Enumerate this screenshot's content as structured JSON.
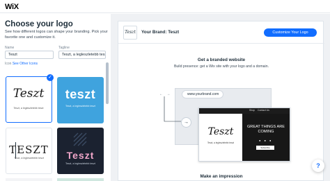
{
  "app": {
    "brand": "WiX"
  },
  "left": {
    "title": "Choose your logo",
    "subtitle": "See how different logos can shape your branding. Pick your favorite one and customize it.",
    "name_label": "Name",
    "name_value": "Teszt",
    "tagline_label": "Tagline",
    "tagline_value": "Teszt, a legleszletebb teszt",
    "icon_prefix": "Icon",
    "icon_link": "See Other Icons",
    "logos": [
      {
        "text": "Teszt",
        "tag": "Teszt, a legleszletebb teszt"
      },
      {
        "text": "teszt",
        "tag": "Teszt, a legleszletebb teszt"
      },
      {
        "text": "TESZT",
        "tag": "Teszt, a legleszletebb teszt"
      },
      {
        "text": "Teszt",
        "tag": "Teszt, a legleszletebb teszt"
      }
    ]
  },
  "right": {
    "brand_title": "Your Brand: Teszt",
    "customize_button": "Customize Your Logo",
    "thumb_text": "Teszt",
    "get_website_title": "Get a branded website",
    "get_website_desc": "Build presence: get a Wix site with your logo and a domain.",
    "url": "www.yourbrand.com",
    "mock_logo": "Teszt",
    "mock_tagline": "Teszt, a legleszletebb teszt",
    "mock_nav_1": "Shop",
    "mock_nav_2": "Contact Us",
    "mock_headline": "GREAT THINGS ARE COMING",
    "mock_button": "Subscribe",
    "make_impression": "Make an impression",
    "help": "?"
  },
  "colors": {
    "accent": "#116dff",
    "dark_tile": "#1b2230",
    "blue_tile": "#3fa3de"
  }
}
